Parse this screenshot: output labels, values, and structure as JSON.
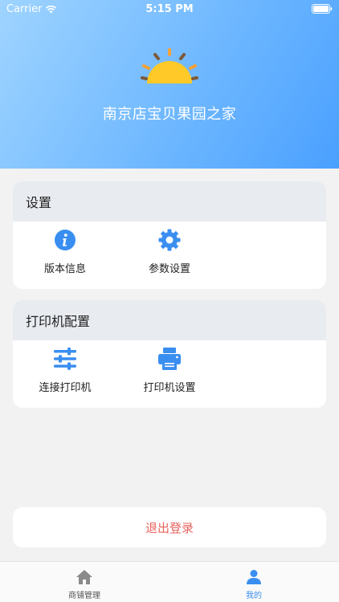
{
  "status_bar": {
    "carrier": "Carrier",
    "time": "5:15 PM"
  },
  "header": {
    "store_name": "南京店宝贝果园之家",
    "icon": "sun-icon"
  },
  "settings": {
    "title": "设置",
    "items": [
      {
        "label": "版本信息",
        "icon": "info-icon"
      },
      {
        "label": "参数设置",
        "icon": "gear-icon"
      }
    ]
  },
  "printer": {
    "title": "打印机配置",
    "items": [
      {
        "label": "连接打印机",
        "icon": "sliders-icon"
      },
      {
        "label": "打印机设置",
        "icon": "printer-icon"
      }
    ]
  },
  "logout_label": "退出登录",
  "tabbar": {
    "items": [
      {
        "label": "商铺管理",
        "icon": "home-icon",
        "active": false
      },
      {
        "label": "我的",
        "icon": "user-icon",
        "active": true
      }
    ]
  },
  "colors": {
    "accent": "#3a8ef0",
    "logout": "#e8625c",
    "header_start": "#9fd4ff",
    "header_end": "#4aa0ff"
  }
}
